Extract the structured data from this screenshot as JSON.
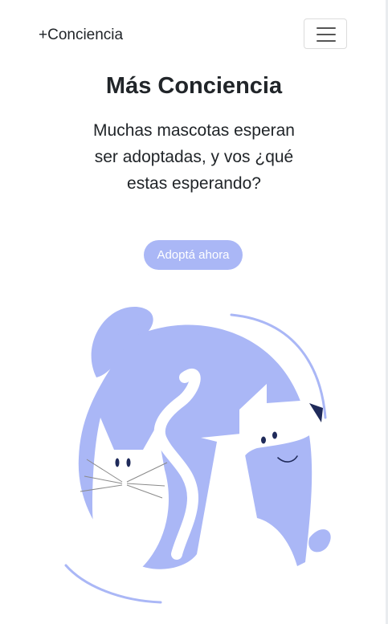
{
  "navbar": {
    "brand": "+Conciencia",
    "toggle_icon": "hamburger-menu-icon"
  },
  "hero": {
    "title": "Más Conciencia",
    "text": "Muchas mascotas esperan ser adoptadas, y vos ¿qué estas esperando?",
    "button_label": "Adoptá ahora"
  },
  "illustration": {
    "icon": "cat-and-dog-illustration",
    "colors": {
      "primary": "#aab7f6",
      "dark": "#1f2a5a",
      "whiskers": "#8a8a8a"
    }
  },
  "colors": {
    "accent": "#aab7f6",
    "text": "#212529"
  }
}
